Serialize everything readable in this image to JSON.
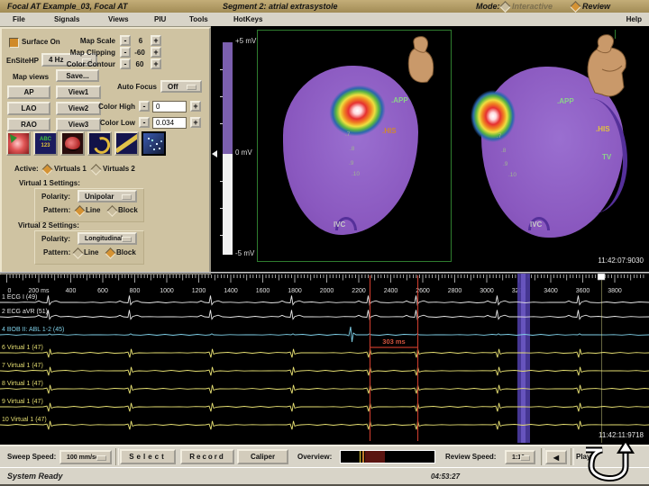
{
  "title_bar": {
    "title": "Focal AT Example_03, Focal AT",
    "segment": "Segment 2: atrial extrasystole",
    "mode_label": "Mode:",
    "mode_inactive": "Interactive",
    "mode_active": "Review"
  },
  "menu_bar": {
    "items": [
      "File",
      "Signals",
      "Views",
      "PIU",
      "Tools",
      "HotKeys"
    ],
    "help": "Help"
  },
  "control_panel": {
    "surface_on": "Surface On",
    "ensite_hp_label": "EnSiteHP",
    "ensite_hp_value": "4 Hz",
    "map_views_label": "Map views",
    "save_button": "Save...",
    "view_buttons": [
      "AP",
      "View1",
      "LAO",
      "View2",
      "RAO",
      "View3"
    ],
    "map_scale": {
      "label": "Map Scale",
      "minus": "-",
      "value": "6",
      "plus": "+"
    },
    "map_clipping": {
      "label": "Map Clipping",
      "minus": "-",
      "value": "-60",
      "plus": "+"
    },
    "color_contour": {
      "label": "Color Contour",
      "minus": "-",
      "value": "60",
      "plus": "+"
    },
    "auto_focus": {
      "label": "Auto Focus",
      "value": "Off"
    },
    "color_high": {
      "label": "Color High",
      "minus": "-",
      "value": "0",
      "plus": "+"
    },
    "color_low": {
      "label": "Color Low",
      "minus": "-",
      "value": "0.034",
      "plus": "+"
    },
    "active_label": "Active:",
    "virtual_radios": [
      {
        "label": "Virtuals 1",
        "selected": true
      },
      {
        "label": "Virtuals 2",
        "selected": false
      }
    ],
    "virtual1": {
      "title": "Virtual 1 Settings:",
      "polarity_label": "Polarity:",
      "polarity_value": "Unipolar",
      "pattern_label": "Pattern:",
      "patterns": [
        {
          "label": "Line",
          "selected": true
        },
        {
          "label": "Block",
          "selected": false
        }
      ]
    },
    "virtual2": {
      "title": "Virtual 2 Settings:",
      "polarity_label": "Polarity:",
      "polarity_value": "Longitudinal",
      "pattern_label": "Pattern:",
      "patterns": [
        {
          "label": "Line",
          "selected": false
        },
        {
          "label": "Block",
          "selected": true
        }
      ]
    }
  },
  "icons": {
    "panel_toolbar": [
      "map-fill-icon",
      "labels-abc123-icon",
      "map-contour-icon",
      "crescent-tool-icon",
      "catheter-tool-icon",
      "virtual-points-icon"
    ],
    "back_button": "left-arrow-icon",
    "cursor_overlay": "u-turn-arrow-icon"
  },
  "map_area": {
    "scale_top": "+5 mV",
    "scale_mid": "0 mV",
    "scale_bottom": "-5 mV",
    "timestamp": "11:42:07:9030",
    "left_view": {
      "app": ".APP",
      "his": ".HIS",
      "ivc": "IVC",
      "points": [
        ".7",
        ".8",
        ".9",
        ".10"
      ]
    },
    "right_view": {
      "app": ".APP",
      "his": ".HIS",
      "tv": "TV",
      "ivc": "IVC",
      "points": [
        ".7",
        ".8",
        ".9",
        ".10"
      ]
    },
    "colors": {
      "surface": "#8a58bf",
      "app_label": "#8cd08c",
      "his_left": "#d08830",
      "his_right": "#e2c23e",
      "tv_label": "#8cd08c",
      "ivc_label": "#c8c8c8"
    }
  },
  "timeline": {
    "ticks": [
      "0",
      "200 ms",
      "400",
      "600",
      "800",
      "1000",
      "1200",
      "1400",
      "1600",
      "1800",
      "2000",
      "2200",
      "2400",
      "2600",
      "2800",
      "3000",
      "3200",
      "3400",
      "3600",
      "3800"
    ]
  },
  "traces": [
    {
      "label": "1 ECG I (49)",
      "color": "#e6e6e6"
    },
    {
      "label": "2 ECG aVR (51)",
      "color": "#e6e6e6"
    },
    {
      "label": "4 BOB II: ABL 1-2 (45)",
      "color": "#7fd0e8"
    },
    {
      "label": "6 Virtual 1 (47)",
      "color": "#e6df72"
    },
    {
      "label": "7 Virtual 1 (47)",
      "color": "#e6df72"
    },
    {
      "label": "8 Virtual 1 (47)",
      "color": "#e6df72"
    },
    {
      "label": "9 Virtual 1 (47)",
      "color": "#e6df72"
    },
    {
      "label": "10 Virtual 1 (47)",
      "color": "#e6df72"
    }
  ],
  "caliper": {
    "value": "303 ms",
    "color": "#c0392b"
  },
  "trace_timestamp": "11:42:11:9718",
  "bottom_bar": {
    "sweep_speed_label": "Sweep Speed:",
    "sweep_speed_value": "100 mm/sec",
    "select_button": "Select",
    "record_button": "Record",
    "caliper_button": "Caliper",
    "overview_label": "Overview:",
    "review_speed_label": "Review Speed:",
    "review_speed_value": "1:10",
    "back_glyph": "◀",
    "play_label": "Play"
  },
  "status_bar": {
    "status": "System Ready",
    "time": "04:53:27"
  }
}
